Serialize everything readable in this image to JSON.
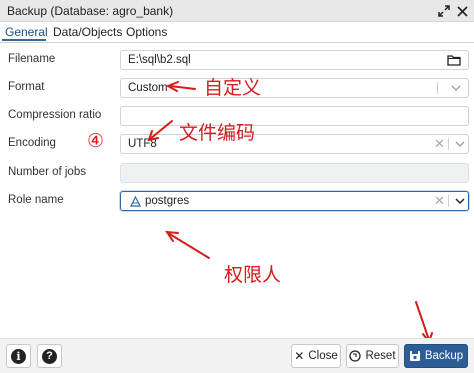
{
  "window": {
    "title": "Backup (Database: agro_bank)"
  },
  "tabs": [
    {
      "label": "General",
      "active": true
    },
    {
      "label": "Data/Objects",
      "active": false
    },
    {
      "label": "Options",
      "active": false
    }
  ],
  "form": {
    "filename": {
      "label": "Filename",
      "value": "E:\\sql\\b2.sql"
    },
    "format": {
      "label": "Format",
      "value": "Custom"
    },
    "compression": {
      "label": "Compression ratio",
      "value": ""
    },
    "encoding": {
      "label": "Encoding",
      "value": "UTF8"
    },
    "jobs": {
      "label": "Number of jobs",
      "value": ""
    },
    "role": {
      "label": "Role name",
      "value": "postgres"
    }
  },
  "annotations": {
    "format_note": "自定义",
    "encoding_note": "文件编码",
    "encoding_number": "④",
    "role_note": "权限人"
  },
  "footer": {
    "close_label": "Close",
    "reset_label": "Reset",
    "backup_label": "Backup"
  },
  "colors": {
    "accent": "#2b5d96",
    "annotation": "#d61b1b",
    "focus_border": "#2c6aa0"
  },
  "icons": {
    "maximize": "expand-icon",
    "close": "close-icon",
    "folder": "folder-icon",
    "role": "user-icon",
    "info": "info-icon",
    "help": "help-icon"
  }
}
